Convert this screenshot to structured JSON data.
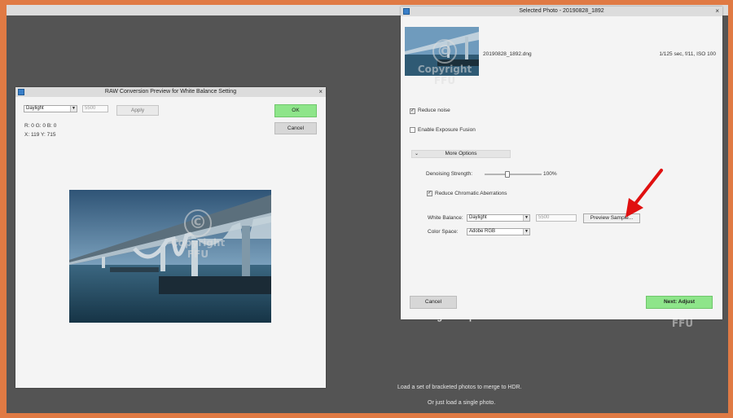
{
  "watermark": {
    "symbol": "©",
    "line1": "Copyright",
    "line2": "FFU"
  },
  "desktop": {
    "drop_text": "Drag & Drop here",
    "hint1": "Load a set of bracketed photos to merge to HDR.",
    "hint2": "Or just load a single photo."
  },
  "raw_dialog": {
    "title": "RAW Conversion Preview for White Balance Setting",
    "close_glyph": "×",
    "preset": "Daylight",
    "temperature": "5500",
    "apply_label": "Apply",
    "ok_label": "OK",
    "cancel_label": "Cancel",
    "rgb_readout": "R: 0   G: 0   B: 0",
    "xy_readout": "X: 119   Y: 715"
  },
  "photo_dialog": {
    "title": "Selected Photo - 20190828_1892",
    "close_glyph": "×",
    "filename": "20190828_1892.dng",
    "exif": "1/125 sec, f/11, ISO 100",
    "reduce_noise_label": "Reduce noise",
    "reduce_noise_checked": true,
    "exposure_fusion_label": "Enable Exposure Fusion",
    "exposure_fusion_checked": false,
    "more_options_label": "More Options",
    "denoising_label": "Denoising Strength:",
    "denoising_value": "100%",
    "denoising_level": 0.4,
    "chromatic_label": "Reduce Chromatic Aberrations",
    "chromatic_checked": true,
    "white_balance_label": "White Balance:",
    "white_balance_value": "Daylight",
    "temperature": "5500",
    "preview_sample_label": "Preview Sample...",
    "color_space_label": "Color Space:",
    "color_space_value": "Adobe RGB",
    "cancel_label": "Cancel",
    "next_label": "Next: Adjust"
  },
  "colors": {
    "frame": "#e07a44",
    "desktop": "#545454",
    "accent_green": "#8ee58a",
    "annotation_arrow": "#e01010"
  }
}
